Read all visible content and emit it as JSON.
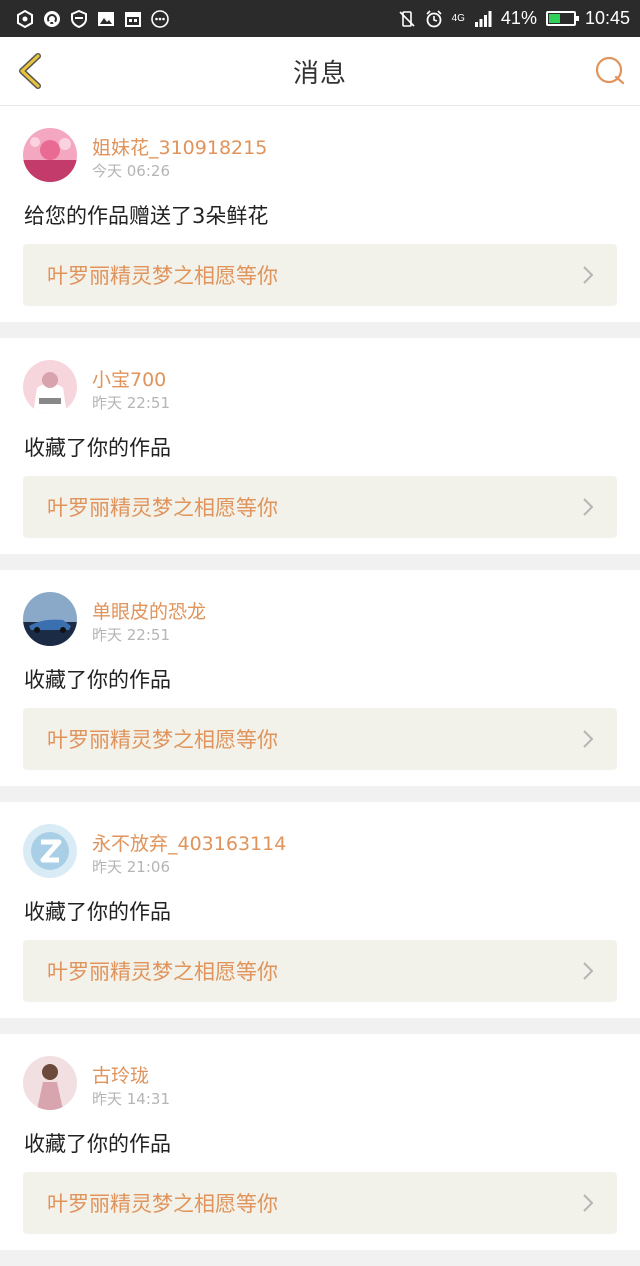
{
  "status_bar": {
    "network": "4G",
    "battery": "41%",
    "battery_level": 0.41,
    "time": "10:45"
  },
  "header": {
    "title": "消息"
  },
  "messages": [
    {
      "username": "姐妹花_310918215",
      "time": "今天 06:26",
      "text": "给您的作品赠送了3朵鲜花",
      "work_title": "叶罗丽精灵梦之相愿等你",
      "avatar_colors": [
        "#f4a7c0",
        "#c23b6b"
      ]
    },
    {
      "username": "小宝700",
      "time": "昨天 22:51",
      "text": "收藏了你的作品",
      "work_title": "叶罗丽精灵梦之相愿等你",
      "avatar_colors": [
        "#f6d6dc",
        "#d9a3ad"
      ]
    },
    {
      "username": "单眼皮的恐龙",
      "time": "昨天 22:51",
      "text": "收藏了你的作品",
      "work_title": "叶罗丽精灵梦之相愿等你",
      "avatar_colors": [
        "#8aa9c9",
        "#1c2b45"
      ]
    },
    {
      "username": "永不放弃_403163114",
      "time": "昨天 21:06",
      "text": "收藏了你的作品",
      "work_title": "叶罗丽精灵梦之相愿等你",
      "avatar_colors": [
        "#d9ecf6",
        "#a9cfe6"
      ]
    },
    {
      "username": "古玲珑",
      "time": "昨天 14:31",
      "text": "收藏了你的作品",
      "work_title": "叶罗丽精灵梦之相愿等你",
      "avatar_colors": [
        "#f2dfe2",
        "#d8a4ae"
      ]
    }
  ],
  "colors": {
    "accent": "#e0935a",
    "back_icon": "#e7c43a",
    "link_bg": "#f3f2ea"
  }
}
